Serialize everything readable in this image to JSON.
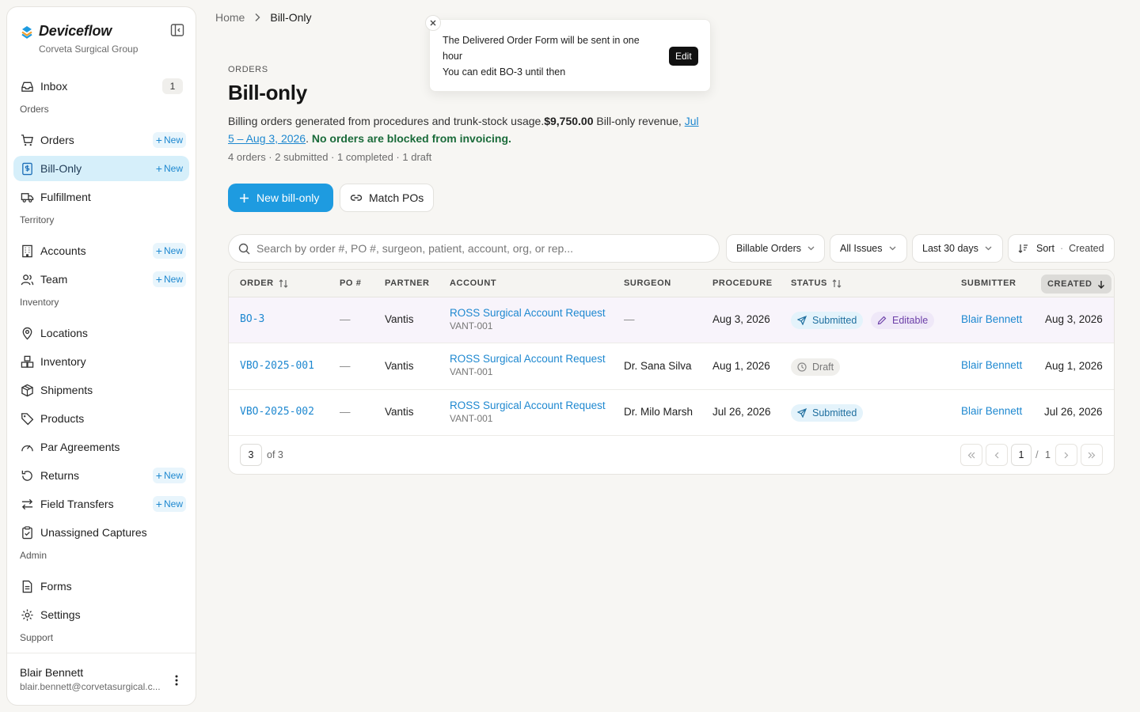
{
  "app": {
    "brand": "Deviceflow",
    "org": "Corveta Surgical Group"
  },
  "sidebar": {
    "inbox": {
      "label": "Inbox",
      "count": "1"
    },
    "sections": {
      "orders": "Orders",
      "territory": "Territory",
      "inventory": "Inventory",
      "admin": "Admin",
      "support": "Support"
    },
    "new_label": "New",
    "items": {
      "orders": "Orders",
      "bill_only": "Bill-Only",
      "fulfillment": "Fulfillment",
      "accounts": "Accounts",
      "team": "Team",
      "locations": "Locations",
      "inventory": "Inventory",
      "shipments": "Shipments",
      "products": "Products",
      "par_agreements": "Par Agreements",
      "returns": "Returns",
      "field_transfers": "Field Transfers",
      "unassigned_captures": "Unassigned Captures",
      "forms": "Forms",
      "settings": "Settings"
    },
    "user": {
      "name": "Blair Bennett",
      "email": "blair.bennett@corvetasurgical.c..."
    }
  },
  "breadcrumb": {
    "home": "Home",
    "current": "Bill-Only"
  },
  "toast": {
    "message": "The Delivered Order Form will be sent in one hour",
    "message2": "You can edit BO-3 until then",
    "edit_label": "Edit"
  },
  "header": {
    "eyebrow": "ORDERS",
    "title": "Bill-only",
    "desc_text": "Billing orders generated from procedures and trunk-stock usage.",
    "desc_amount": "$9,750.00",
    "desc_revenue": "Bill-only revenue,",
    "desc_range": "Jul 5 – Aug 3, 2026",
    "desc_period": ".",
    "desc_status": "No orders are blocked from invoicing.",
    "counts": "4 orders · 2 submitted · 1 completed · 1 draft"
  },
  "actions": {
    "new_bill_only": "New bill-only",
    "match_pos": "Match POs"
  },
  "filters": {
    "search_placeholder": "Search by order #, PO #, surgeon, patient, account, org, or rep...",
    "type": "Billable Orders",
    "issues": "All Issues",
    "range": "Last 30 days",
    "sort_label": "Sort",
    "sort_sep": "·",
    "sort_value": "Created"
  },
  "table": {
    "columns": {
      "order": "ORDER",
      "po": "PO #",
      "partner": "PARTNER",
      "account": "ACCOUNT",
      "surgeon": "SURGEON",
      "procedure": "PROCEDURE",
      "status": "STATUS",
      "submitter": "SUBMITTER",
      "created": "CREATED"
    },
    "rows": [
      {
        "order": "BO-3",
        "po": "—",
        "partner": "Vantis",
        "account": "ROSS Surgical Account Request",
        "account_code": "VANT-001",
        "surgeon": "—",
        "procedure": "Aug 3, 2026",
        "status": "Submitted",
        "editable": "Editable",
        "submitter": "Blair Bennett",
        "created": "Aug 3, 2026"
      },
      {
        "order": "VBO-2025-001",
        "po": "—",
        "partner": "Vantis",
        "account": "ROSS Surgical Account Request",
        "account_code": "VANT-001",
        "surgeon": "Dr. Sana Silva",
        "procedure": "Aug 1, 2026",
        "status": "Draft",
        "submitter": "Blair Bennett",
        "created": "Aug 1, 2026"
      },
      {
        "order": "VBO-2025-002",
        "po": "—",
        "partner": "Vantis",
        "account": "ROSS Surgical Account Request",
        "account_code": "VANT-001",
        "surgeon": "Dr. Milo Marsh",
        "procedure": "Jul 26, 2026",
        "status": "Submitted",
        "submitter": "Blair Bennett",
        "created": "Jul 26, 2026"
      }
    ]
  },
  "pagination": {
    "page_size": "3",
    "of_total": "of 3",
    "current": "1",
    "slash": "/",
    "total_pages": "1"
  },
  "colors": {
    "accent": "#1e9be0",
    "link": "#1e88d0",
    "active_nav": "#d6effa",
    "success": "#1a6b3a"
  }
}
